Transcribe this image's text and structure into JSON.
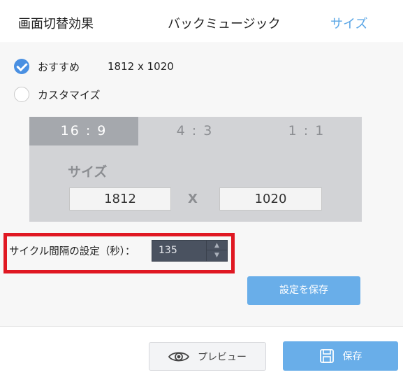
{
  "tabs": [
    {
      "label": "画面切替効果"
    },
    {
      "label": "バックミュージック"
    },
    {
      "label": "サイズ"
    }
  ],
  "size_options": {
    "recommended_label": "おすすめ",
    "recommended_size": "1812 x 1020",
    "custom_label": "カスタマイズ",
    "selected": "recommended"
  },
  "ratio_tabs": [
    "16 : 9",
    "4 : 3",
    "1 : 1"
  ],
  "selected_ratio": "16 : 9",
  "size_fields": {
    "label": "サイズ",
    "width": "1812",
    "separator": "X",
    "height": "1020"
  },
  "cycle": {
    "label": "サイクル間隔の設定（秒）：",
    "value": "135"
  },
  "buttons": {
    "save_settings": "設定を保存",
    "preview": "プレビュー",
    "save": "保存"
  },
  "colors": {
    "accent": "#69aee9",
    "highlight_border": "#e01822",
    "active_tab_text": "#5aa6e6"
  },
  "icons": {
    "preview": "eye-icon",
    "save": "floppy-disk-icon",
    "checked": "checkmark-icon",
    "stepper_up": "chevron-up-icon",
    "stepper_down": "chevron-down-icon"
  }
}
